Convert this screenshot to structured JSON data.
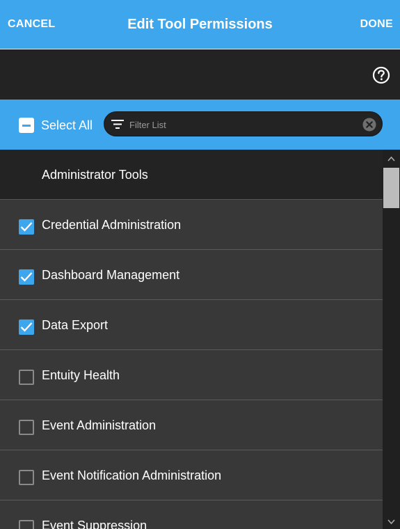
{
  "header": {
    "cancel_label": "CANCEL",
    "title": "Edit Tool Permissions",
    "done_label": "DONE"
  },
  "toolbar": {
    "help_icon": "question-circle-icon"
  },
  "filter_bar": {
    "select_all_label": "Select All",
    "select_all_state": "indeterminate",
    "filter_placeholder": "Filter List",
    "filter_value": ""
  },
  "list": {
    "group_label": "Administrator Tools",
    "items": [
      {
        "label": "Credential Administration",
        "checked": true
      },
      {
        "label": "Dashboard Management",
        "checked": true
      },
      {
        "label": "Data Export",
        "checked": true
      },
      {
        "label": "Entuity Health",
        "checked": false
      },
      {
        "label": "Event Administration",
        "checked": false
      },
      {
        "label": "Event Notification Administration",
        "checked": false
      },
      {
        "label": "Event Suppression",
        "checked": false
      }
    ]
  },
  "colors": {
    "accent": "#3ea6ec",
    "toolbar_bg": "#232323",
    "row_bg": "#383838"
  }
}
